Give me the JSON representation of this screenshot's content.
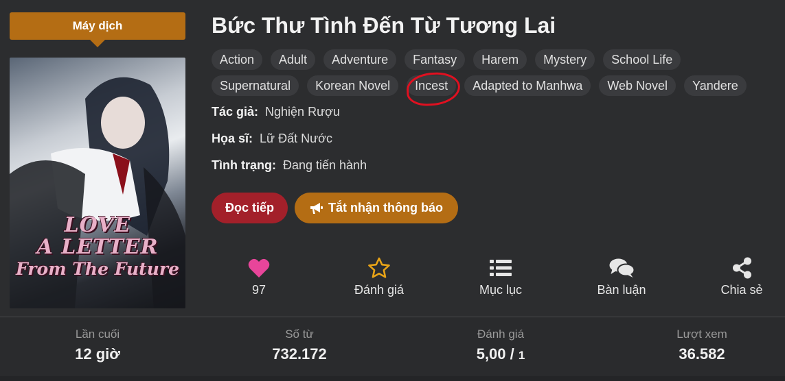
{
  "badge": "Máy dịch",
  "cover": {
    "line1": "LOVE",
    "line2": "A LETTER",
    "line3": "From The Future"
  },
  "title": "Bức Thư Tình Đến Từ Tương Lai",
  "genres_row1": [
    "Action",
    "Adult",
    "Adventure",
    "Fantasy",
    "Harem",
    "Mystery",
    "School Life"
  ],
  "genres_row2": [
    "Supernatural",
    "Korean Novel",
    "Incest",
    "Adapted to Manhwa",
    "Web Novel",
    "Yandere"
  ],
  "meta": {
    "author_label": "Tác giả:",
    "author": "Nghiện Rượu",
    "artist_label": "Họa sĩ:",
    "artist": "Lữ Đất Nước",
    "status_label": "Tình trạng:",
    "status": "Đang tiến hành"
  },
  "buttons": {
    "read": "Đọc tiếp",
    "follow": "Tắt nhận thông báo"
  },
  "actions": {
    "likes": "97",
    "rate": "Đánh giá",
    "toc": "Mục lục",
    "comments": "Bàn luận",
    "share": "Chia sẻ"
  },
  "stats": {
    "last_label": "Lần cuối",
    "last_value": "12 giờ",
    "words_label": "Số từ",
    "words_value": "732.172",
    "rating_label": "Đánh giá",
    "rating_value": "5,00 / ",
    "rating_count": "1",
    "views_label": "Lượt xem",
    "views_value": "36.582"
  },
  "colors": {
    "background": "#2c2d2f",
    "accent_orange": "#b46d14",
    "read_red": "#a3202a",
    "heart_pink": "#e8459a",
    "star_orange": "#e8a317",
    "annotation_red": "#e01020"
  },
  "icons": [
    "heart-icon",
    "star-icon",
    "list-icon",
    "comments-icon",
    "share-icon",
    "megaphone-icon"
  ]
}
